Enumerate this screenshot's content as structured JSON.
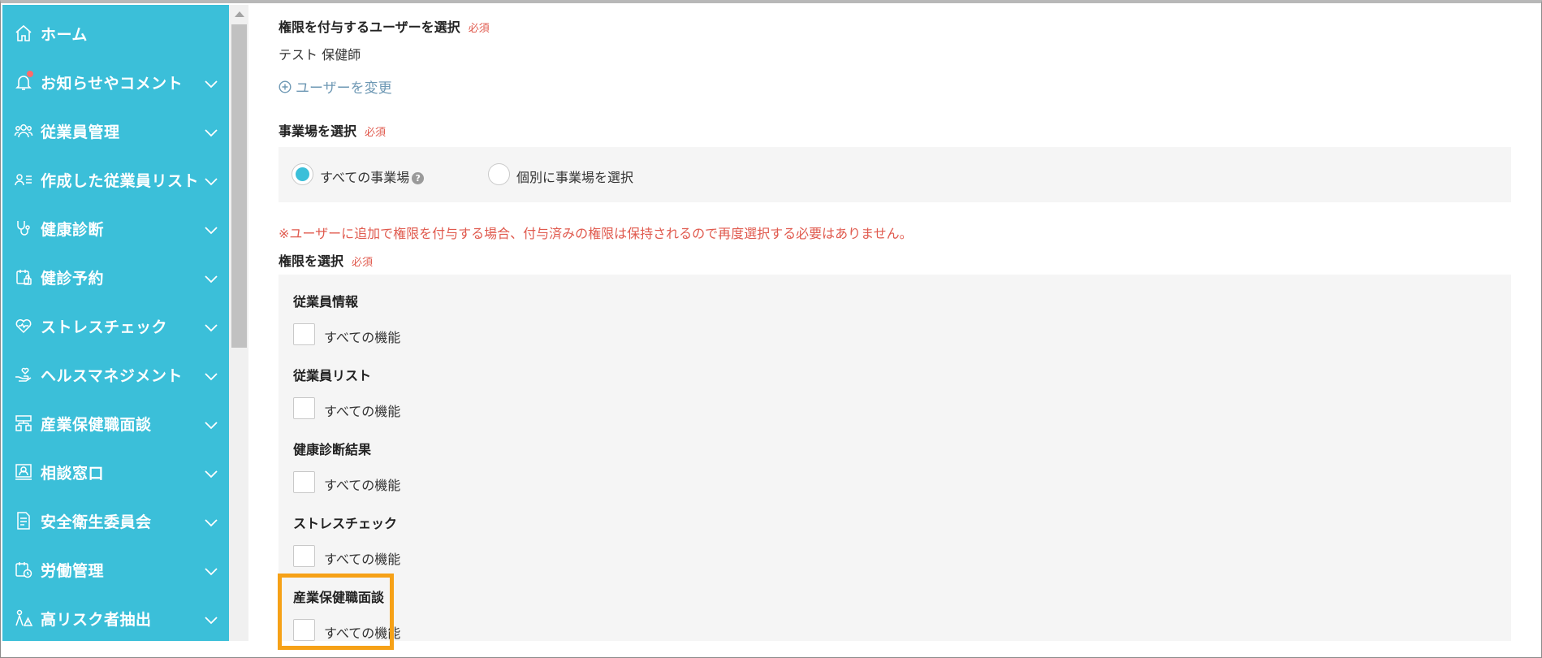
{
  "sidebar": {
    "items": [
      {
        "label": "ホーム",
        "icon": "home-icon",
        "has_chevron": false
      },
      {
        "label": "お知らせやコメント",
        "icon": "bell-icon",
        "has_chevron": true,
        "has_badge": true
      },
      {
        "label": "従業員管理",
        "icon": "users-icon",
        "has_chevron": true
      },
      {
        "label": "作成した従業員リスト",
        "icon": "user-list-icon",
        "has_chevron": true
      },
      {
        "label": "健康診断",
        "icon": "stethoscope-icon",
        "has_chevron": true
      },
      {
        "label": "健診予約",
        "icon": "calendar-lock-icon",
        "has_chevron": true
      },
      {
        "label": "ストレスチェック",
        "icon": "heart-icon",
        "has_chevron": true
      },
      {
        "label": "ヘルスマネジメント",
        "icon": "hand-heart-icon",
        "has_chevron": true
      },
      {
        "label": "産業保健職面談",
        "icon": "org-chart-icon",
        "has_chevron": true
      },
      {
        "label": "相談窓口",
        "icon": "consult-icon",
        "has_chevron": true
      },
      {
        "label": "安全衛生委員会",
        "icon": "document-icon",
        "has_chevron": true
      },
      {
        "label": "労働管理",
        "icon": "calendar-clock-icon",
        "has_chevron": true
      },
      {
        "label": "高リスク者抽出",
        "icon": "warning-person-icon",
        "has_chevron": true
      }
    ],
    "color": "#3bbfd9"
  },
  "form": {
    "user_section": {
      "title": "権限を付与するユーザーを選択",
      "required": "必須",
      "selected_user": "テスト 保健師",
      "change_link": "ユーザーを変更"
    },
    "site_section": {
      "title": "事業場を選択",
      "required": "必須",
      "options": [
        {
          "label": "すべての事業場",
          "checked": true,
          "help": "?"
        },
        {
          "label": "個別に事業場を選択",
          "checked": false
        }
      ]
    },
    "warning": "※ユーザーに追加で権限を付与する場合、付与済みの権限は保持されるので再度選択する必要はありません。",
    "permission_section": {
      "title": "権限を選択",
      "required": "必須",
      "groups": [
        {
          "title": "従業員情報",
          "option": "すべての機能",
          "checked": false
        },
        {
          "title": "従業員リスト",
          "option": "すべての機能",
          "checked": false
        },
        {
          "title": "健康診断結果",
          "option": "すべての機能",
          "checked": false
        },
        {
          "title": "ストレスチェック",
          "option": "すべての機能",
          "checked": false
        },
        {
          "title": "産業保健職面談",
          "option": "すべての機能",
          "checked": false,
          "highlighted": true
        }
      ]
    }
  },
  "colors": {
    "accent": "#3bbfd9",
    "required": "#e05a4e",
    "link": "#6e98b4",
    "highlight": "#f6a117"
  }
}
